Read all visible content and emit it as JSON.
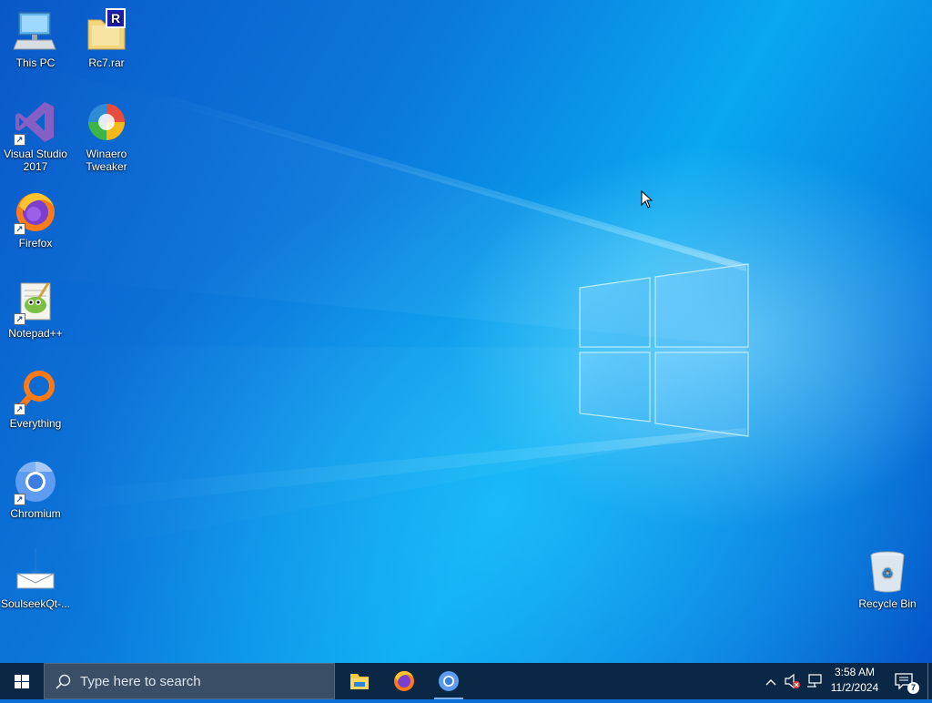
{
  "desktop": {
    "icons": [
      {
        "label": "This PC",
        "icon": "computer-icon"
      },
      {
        "label": "Rc7.rar",
        "icon": "rar-archive-icon"
      },
      {
        "label": "Visual Studio\n2017",
        "icon": "visual-studio-icon",
        "shortcut": true
      },
      {
        "label": "Winaero\nTweaker",
        "icon": "winaero-tweaker-icon"
      },
      {
        "label": "Firefox",
        "icon": "firefox-icon",
        "shortcut": true
      },
      {
        "label": "Notepad++",
        "icon": "notepadpp-icon",
        "shortcut": true
      },
      {
        "label": "Everything",
        "icon": "everything-search-icon",
        "shortcut": true
      },
      {
        "label": "Chromium",
        "icon": "chromium-icon",
        "shortcut": true
      },
      {
        "label": "SoulseekQt-...",
        "icon": "download-icon"
      },
      {
        "label": "Recycle Bin",
        "icon": "recycle-bin-icon"
      }
    ],
    "shortcut_arrow": "↗"
  },
  "taskbar": {
    "start_icon": "windows-logo-icon",
    "search_placeholder": "Type here to search",
    "search_icon": "search-icon",
    "pinned_apps": [
      {
        "name": "File Explorer",
        "icon": "file-explorer-icon"
      },
      {
        "name": "Firefox",
        "icon": "firefox-icon"
      },
      {
        "name": "Chromium",
        "icon": "chromium-icon"
      }
    ],
    "tray": {
      "overflow_icon": "chevron-up-icon",
      "volume_icon": "volume-muted-icon",
      "network_icon": "network-icon",
      "time": "3:58 AM",
      "date": "11/2/2024",
      "notification_icon": "action-center-icon",
      "notification_count": "7"
    }
  },
  "colors": {
    "taskbar": "#0b2746",
    "search_box": "#3a4f66",
    "desktop_blue": "#0a6fd6",
    "win_logo_glow": "#aee8ff"
  }
}
